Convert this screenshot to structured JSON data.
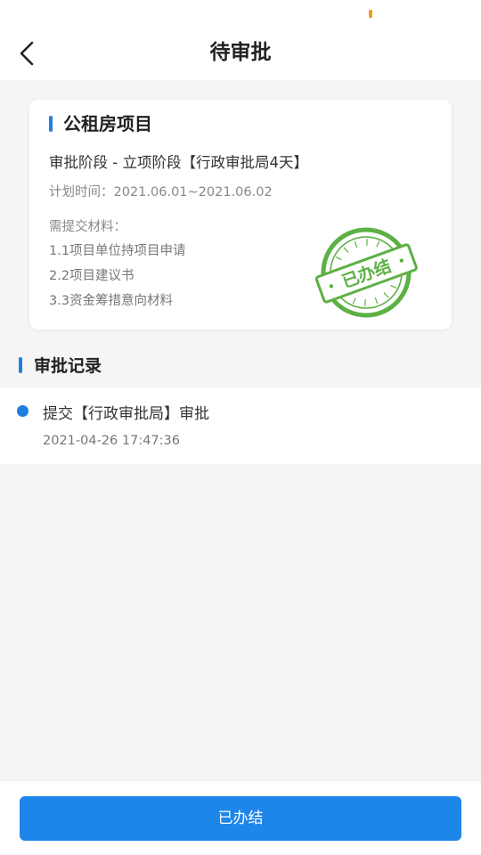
{
  "nav": {
    "title": "待审批",
    "back_icon": "chevron-left-icon"
  },
  "project": {
    "title": "公租房项目",
    "stage": "审批阶段 - 立项阶段【行政审批局4天】",
    "plan_time": "计划时间：2021.06.01~2021.06.02",
    "materials_label": "需提交材料：",
    "materials": [
      "1.1项目单位持项目申请",
      "2.2项目建议书",
      "3.3资金筹措意向材料"
    ],
    "stamp_text": "已办结",
    "stamp_color": "#5db043"
  },
  "records": {
    "title": "审批记录",
    "items": [
      {
        "text": "提交【行政审批局】审批",
        "time": "2021-04-26 17:47:36"
      }
    ]
  },
  "footer": {
    "button_label": "已办结"
  },
  "colors": {
    "accent": "#1f7fe0",
    "button": "#1e86e8",
    "background": "#f5f5f5"
  }
}
